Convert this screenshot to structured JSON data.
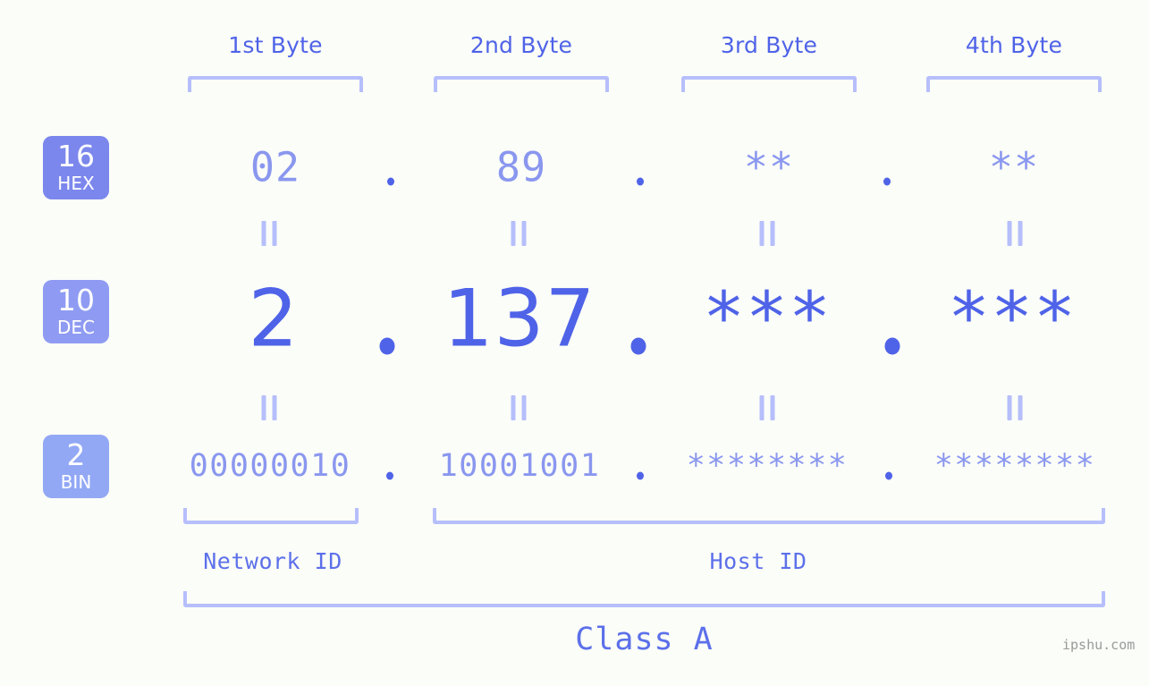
{
  "background_color": "#fbfdf8",
  "accent_color": "#4f63e8",
  "muted_accent_color": "#8a97ef",
  "bracket_color": "#b6bffc",
  "byte_headers": [
    {
      "label": "1st Byte"
    },
    {
      "label": "2nd Byte"
    },
    {
      "label": "3rd Byte"
    },
    {
      "label": "4th Byte"
    }
  ],
  "bases": {
    "hex": {
      "number": "16",
      "abbr": "HEX",
      "badge_color": "#7b87ec"
    },
    "dec": {
      "number": "10",
      "abbr": "DEC",
      "badge_color": "#8f9bf2"
    },
    "bin": {
      "number": "2",
      "abbr": "BIN",
      "badge_color": "#92a8f5"
    }
  },
  "rows": {
    "hex": {
      "values": [
        "02",
        "89",
        "**",
        "**"
      ]
    },
    "dec": {
      "values": [
        "2",
        "137",
        "***",
        "***"
      ]
    },
    "bin": {
      "values": [
        "00000010",
        "10001001",
        "********",
        "********"
      ]
    }
  },
  "separator": ".",
  "equality_mark": "||",
  "segments": {
    "network_id": "Network ID",
    "host_id": "Host ID"
  },
  "class_label": "Class A",
  "watermark": "ipshu.com"
}
